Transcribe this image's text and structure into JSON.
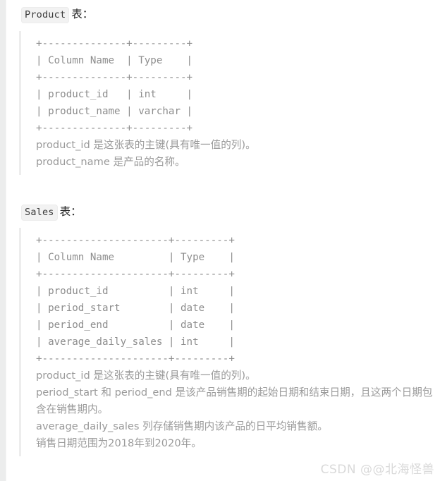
{
  "page": {
    "background_color": "#ffffff",
    "edge_strip_color": "#eceded",
    "quote_rule_color": "#ededed",
    "code_text_color": "#8d8d8d",
    "body_text_color": "#9a9a9a",
    "heading_text_color": "#262626",
    "watermark_color": "#d9d9d9"
  },
  "sections": [
    {
      "code_label": "Product",
      "heading_suffix": "表：",
      "ascii_table": "+--------------+---------+\n| Column Name  | Type    |\n+--------------+---------+\n| product_id   | int     |\n| product_name | varchar |\n+--------------+---------+",
      "table_columns": [
        "Column Name",
        "Type"
      ],
      "table_rows": [
        [
          "product_id",
          "int"
        ],
        [
          "product_name",
          "varchar"
        ]
      ],
      "descriptions": [
        "product_id 是这张表的主键(具有唯一值的列)。",
        "product_name 是产品的名称。"
      ]
    },
    {
      "code_label": "Sales",
      "heading_suffix": "表：",
      "ascii_table": "+---------------------+---------+\n| Column Name         | Type    |\n+---------------------+---------+\n| product_id          | int     |\n| period_start        | date    |\n| period_end          | date    |\n| average_daily_sales | int     |\n+---------------------+---------+",
      "table_columns": [
        "Column Name",
        "Type"
      ],
      "table_rows": [
        [
          "product_id",
          "int"
        ],
        [
          "period_start",
          "date"
        ],
        [
          "period_end",
          "date"
        ],
        [
          "average_daily_sales",
          "int"
        ]
      ],
      "descriptions": [
        "product_id 是这张表的主键(具有唯一值的列)。",
        "period_start 和 period_end 是该产品销售期的起始日期和结束日期，且这两个日期包含在销售期内。",
        "average_daily_sales 列存储销售期内该产品的日平均销售额。",
        "销售日期范围为2018年到2020年。"
      ]
    }
  ],
  "watermark": {
    "text": "CSDN @@北海怪兽"
  }
}
